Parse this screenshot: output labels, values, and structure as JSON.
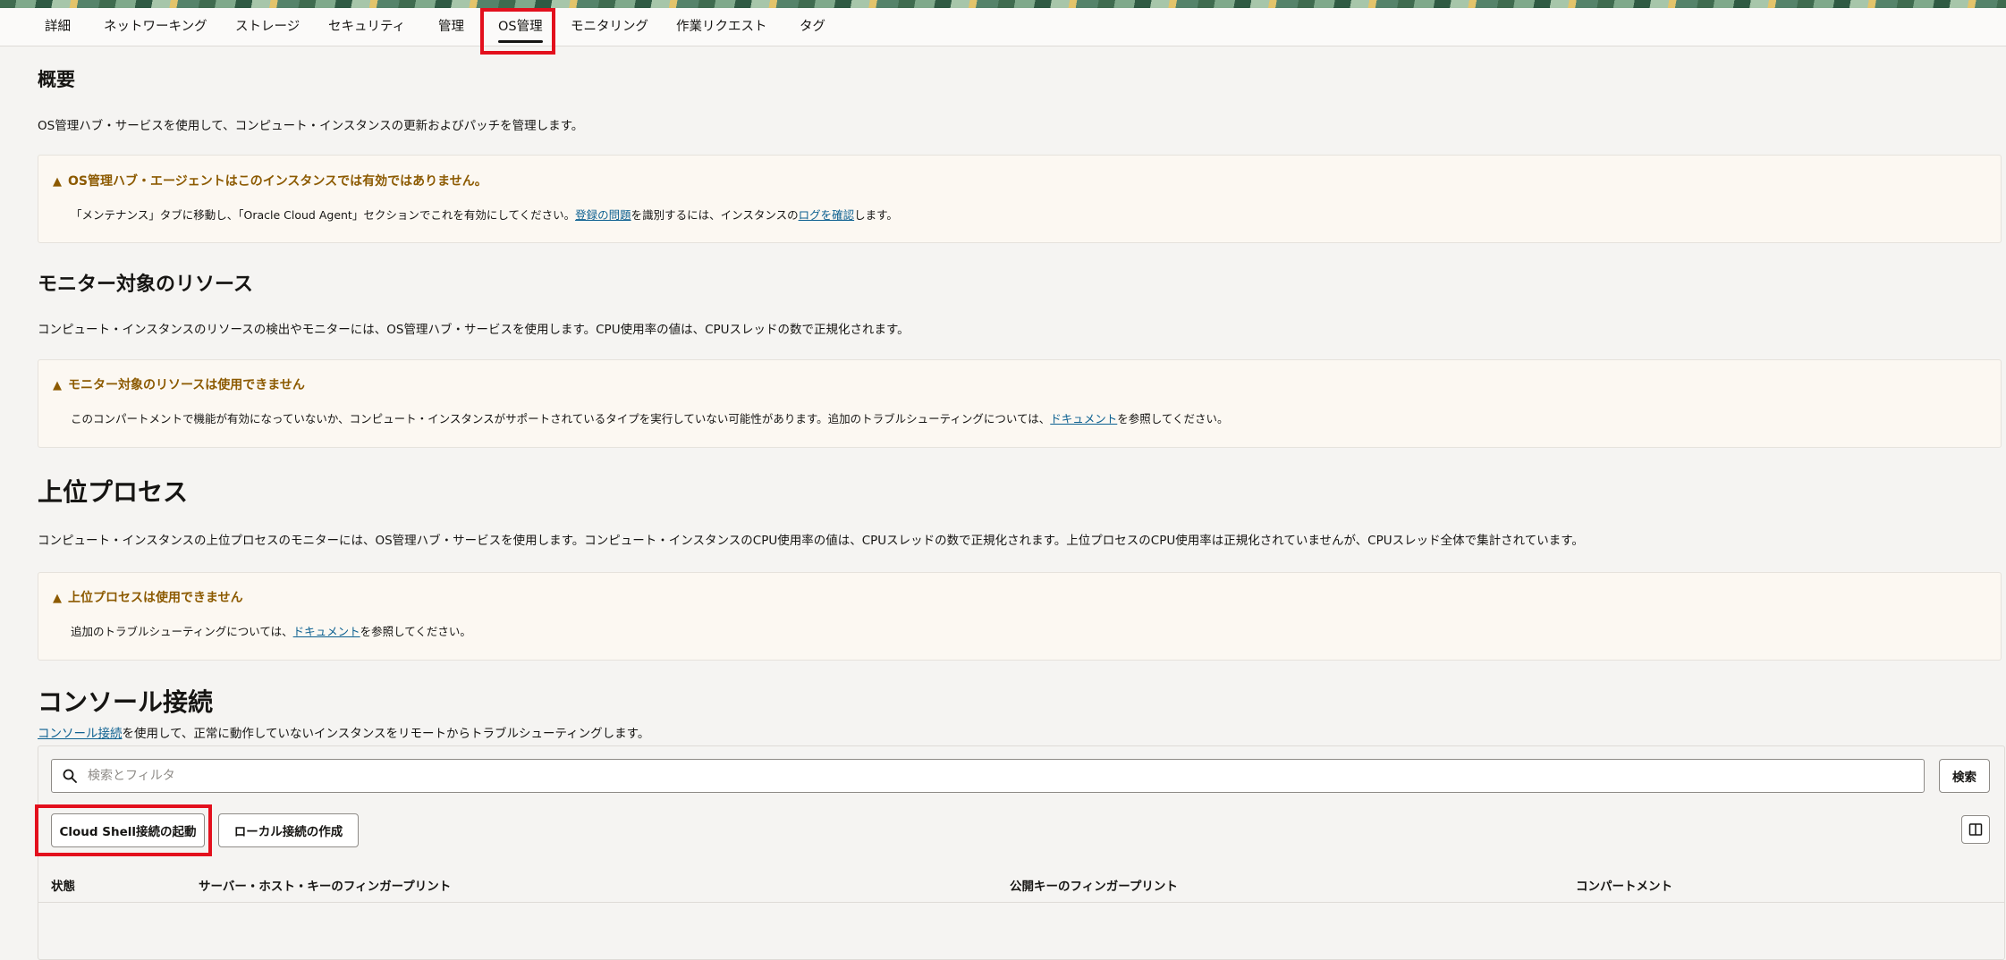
{
  "tabs": [
    {
      "label": "詳細"
    },
    {
      "label": "ネットワーキング"
    },
    {
      "label": "ストレージ"
    },
    {
      "label": "セキュリティ"
    },
    {
      "label": "管理"
    },
    {
      "label": "OS管理"
    },
    {
      "label": "モニタリング"
    },
    {
      "label": "作業リクエスト"
    },
    {
      "label": "タグ"
    }
  ],
  "active_tab": "OS管理",
  "overview": {
    "title": "概要",
    "description": "OS管理ハブ・サービスを使用して、コンピュート・インスタンスの更新およびパッチを管理します。",
    "alert": {
      "title": "OS管理ハブ・エージェントはこのインスタンスでは有効ではありません。",
      "body_pre": "「メンテナンス」タブに移動し、「Oracle Cloud Agent」セクションでこれを有効にしてください。",
      "link1": "登録の問題",
      "body_mid": "を識別するには、インスタンスの",
      "link2": "ログを確認",
      "body_post": "します。"
    }
  },
  "monitored": {
    "title": "モニター対象のリソース",
    "description": "コンピュート・インスタンスのリソースの検出やモニターには、OS管理ハブ・サービスを使用します。CPU使用率の値は、CPUスレッドの数で正規化されます。",
    "alert": {
      "title": "モニター対象のリソースは使用できません",
      "body_pre": "このコンパートメントで機能が有効になっていないか、コンピュート・インスタンスがサポートされているタイプを実行していない可能性があります。追加のトラブルシューティングについては、",
      "link": "ドキュメント",
      "body_post": "を参照してください。"
    }
  },
  "top_processes": {
    "title": "上位プロセス",
    "description": "コンピュート・インスタンスの上位プロセスのモニターには、OS管理ハブ・サービスを使用します。コンピュート・インスタンスのCPU使用率の値は、CPUスレッドの数で正規化されます。上位プロセスのCPU使用率は正規化されていませんが、CPUスレッド全体で集計されています。",
    "alert": {
      "title": "上位プロセスは使用できません",
      "body_pre": "追加のトラブルシューティングについては、",
      "link": "ドキュメント",
      "body_post": "を参照してください。"
    }
  },
  "console": {
    "title": "コンソール接続",
    "desc_link": "コンソール接続",
    "desc_rest": "を使用して、正常に動作していないインスタンスをリモートからトラブルシューティングします。",
    "search_placeholder": "検索とフィルタ",
    "search_button": "検索",
    "launch_cloud_shell": "Cloud Shell接続の起動",
    "create_local": "ローカル接続の作成",
    "columns": [
      "状態",
      "サーバー・ホスト・キーのフィンガープリント",
      "公開キーのフィンガープリント",
      "コンパートメント"
    ]
  },
  "colors": {
    "highlight": "#e3101d",
    "warning": "#8c5a00",
    "link": "#0e6191"
  }
}
